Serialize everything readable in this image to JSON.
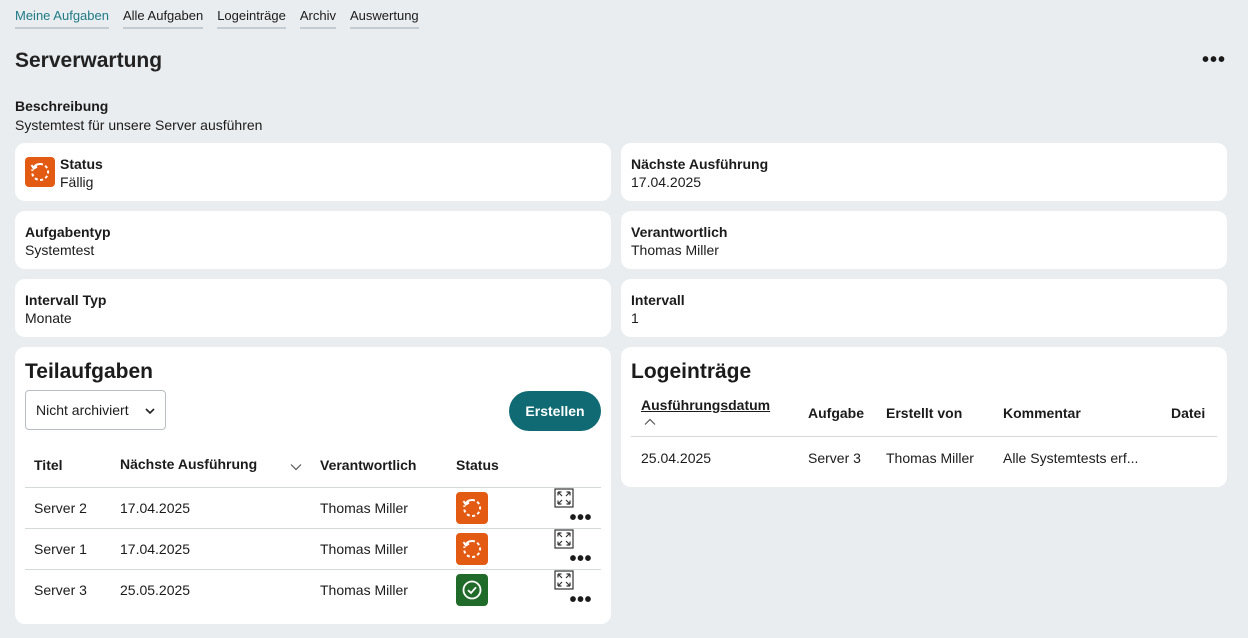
{
  "tabs": [
    "Meine Aufgaben",
    "Alle Aufgaben",
    "Logeinträge",
    "Archiv",
    "Auswertung"
  ],
  "page": {
    "title": "Serverwartung",
    "more_label": "•••",
    "description_label": "Beschreibung",
    "description_value": "Systemtest für unsere Server ausführen"
  },
  "fields": {
    "status": {
      "label": "Status",
      "value": "Fällig",
      "icon": "refresh-icon",
      "color": "#e35a12"
    },
    "next_run": {
      "label": "Nächste Ausführung",
      "value": "17.04.2025"
    },
    "task_type": {
      "label": "Aufgabentyp",
      "value": "Systemtest"
    },
    "responsible": {
      "label": "Verantwortlich",
      "value": "Thomas Miller"
    },
    "interval_type": {
      "label": "Intervall Typ",
      "value": "Monate"
    },
    "interval": {
      "label": "Intervall",
      "value": "1"
    }
  },
  "subtasks": {
    "title": "Teilaufgaben",
    "filter": "Nicht archiviert",
    "create_label": "Erstellen",
    "columns": [
      "Titel",
      "Nächste Ausführung",
      "Verantwortlich",
      "Status"
    ],
    "rows": [
      {
        "title": "Server 2",
        "next": "17.04.2025",
        "responsible": "Thomas Miller",
        "status": "due",
        "more": "•••"
      },
      {
        "title": "Server 1",
        "next": "17.04.2025",
        "responsible": "Thomas Miller",
        "status": "due",
        "more": "•••"
      },
      {
        "title": "Server 3",
        "next": "25.05.2025",
        "responsible": "Thomas Miller",
        "status": "done",
        "more": "•••"
      }
    ]
  },
  "logs": {
    "title": "Logeinträge",
    "columns": [
      "Ausführungsdatum",
      "Aufgabe",
      "Erstellt von",
      "Kommentar",
      "Datei"
    ],
    "rows": [
      {
        "date": "25.04.2025",
        "task": "Server 3",
        "created_by": "Thomas Miller",
        "comment": "Alle Systemtests erf...",
        "file": ""
      }
    ]
  },
  "colors": {
    "accent": "#0f6a73",
    "due": "#e35a12",
    "done": "#216b2a",
    "active_tab": "#1f7b86"
  }
}
